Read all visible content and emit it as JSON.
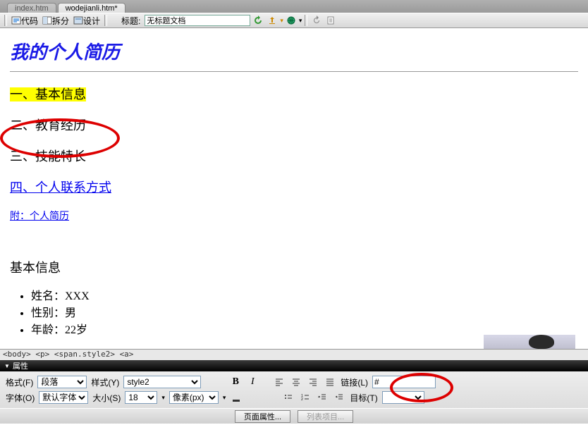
{
  "tabs": [
    {
      "label": "index.htm"
    },
    {
      "label": "wodejianli.htm*"
    }
  ],
  "toolbar": {
    "code": "代码",
    "split": "拆分",
    "design": "设计",
    "title_label": "标题:",
    "title_value": "无标题文档"
  },
  "doc": {
    "h1": "我的个人简历",
    "s1": "一、基本信息",
    "s2": "二、教育经历",
    "s3": "三、技能特长",
    "s4": "四、个人联系方式",
    "att": "附：个人简历",
    "info_title": "基本信息",
    "li1": "姓名：XXX",
    "li2": "性别：男",
    "li3": "年龄：22岁"
  },
  "pathbar": "<body> <p> <span.style2> <a>",
  "panel": {
    "title": "属性"
  },
  "props": {
    "format_label": "格式(F)",
    "format_value": "段落",
    "style_label": "样式(Y)",
    "style_value": "style2",
    "font_label": "字体(O)",
    "font_value": "默认字体",
    "size_label": "大小(S)",
    "size_value": "18",
    "unit_value": "像素(px)",
    "link_label": "链接(L)",
    "link_value": "#",
    "target_label": "目标(T)",
    "target_value": ""
  },
  "bottom": {
    "page_props": "页面属性...",
    "list_item": "列表项目..."
  }
}
